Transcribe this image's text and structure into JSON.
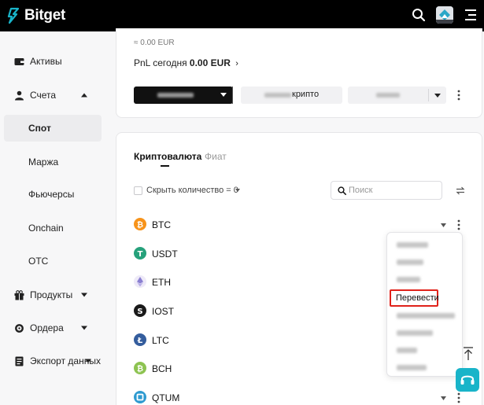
{
  "brand": {
    "name": "Bitget",
    "accent": "#19b4c9"
  },
  "header": {
    "search_icon": "search-icon",
    "menu_icon": "hamburger-icon"
  },
  "sidebar": {
    "items": [
      {
        "label": "Активы",
        "icon": "wallet-icon"
      },
      {
        "label": "Счета",
        "icon": "user-icon",
        "expanded": true
      },
      {
        "label": "Спот",
        "active": true
      },
      {
        "label": "Маржа"
      },
      {
        "label": "Фьючерсы"
      },
      {
        "label": "Onchain"
      },
      {
        "label": "OTC"
      },
      {
        "label": "Продукты",
        "icon": "gift-icon"
      },
      {
        "label": "Ордера",
        "icon": "gear-icon"
      },
      {
        "label": "Экспорт данных",
        "icon": "export-icon"
      }
    ]
  },
  "summary": {
    "approx_value": "≈ 0.00 EUR",
    "pnl_label": "PnL сегодня",
    "pnl_value": "0.00 EUR",
    "btn_crypto_suffix": "крипто"
  },
  "assets": {
    "tabs": [
      {
        "label": "Криптовалюта",
        "active": true
      },
      {
        "label": "Фиат",
        "active": false
      }
    ],
    "hide_label": "Скрыть количество = 0",
    "search_placeholder": "Поиск",
    "coins": [
      {
        "symbol": "BTC",
        "color": "#f7931a"
      },
      {
        "symbol": "USDT",
        "color": "#26a17b"
      },
      {
        "symbol": "ETH",
        "color": "#e9e6f5"
      },
      {
        "symbol": "IOST",
        "color": "#1a1a1a"
      },
      {
        "symbol": "LTC",
        "color": "#345d9d"
      },
      {
        "symbol": "BCH",
        "color": "#8dc351"
      },
      {
        "symbol": "QTUM",
        "color": "#2e9ad0"
      }
    ]
  },
  "menu": {
    "transfer_label": "Перевести",
    "highlight_color": "#e0221a"
  }
}
